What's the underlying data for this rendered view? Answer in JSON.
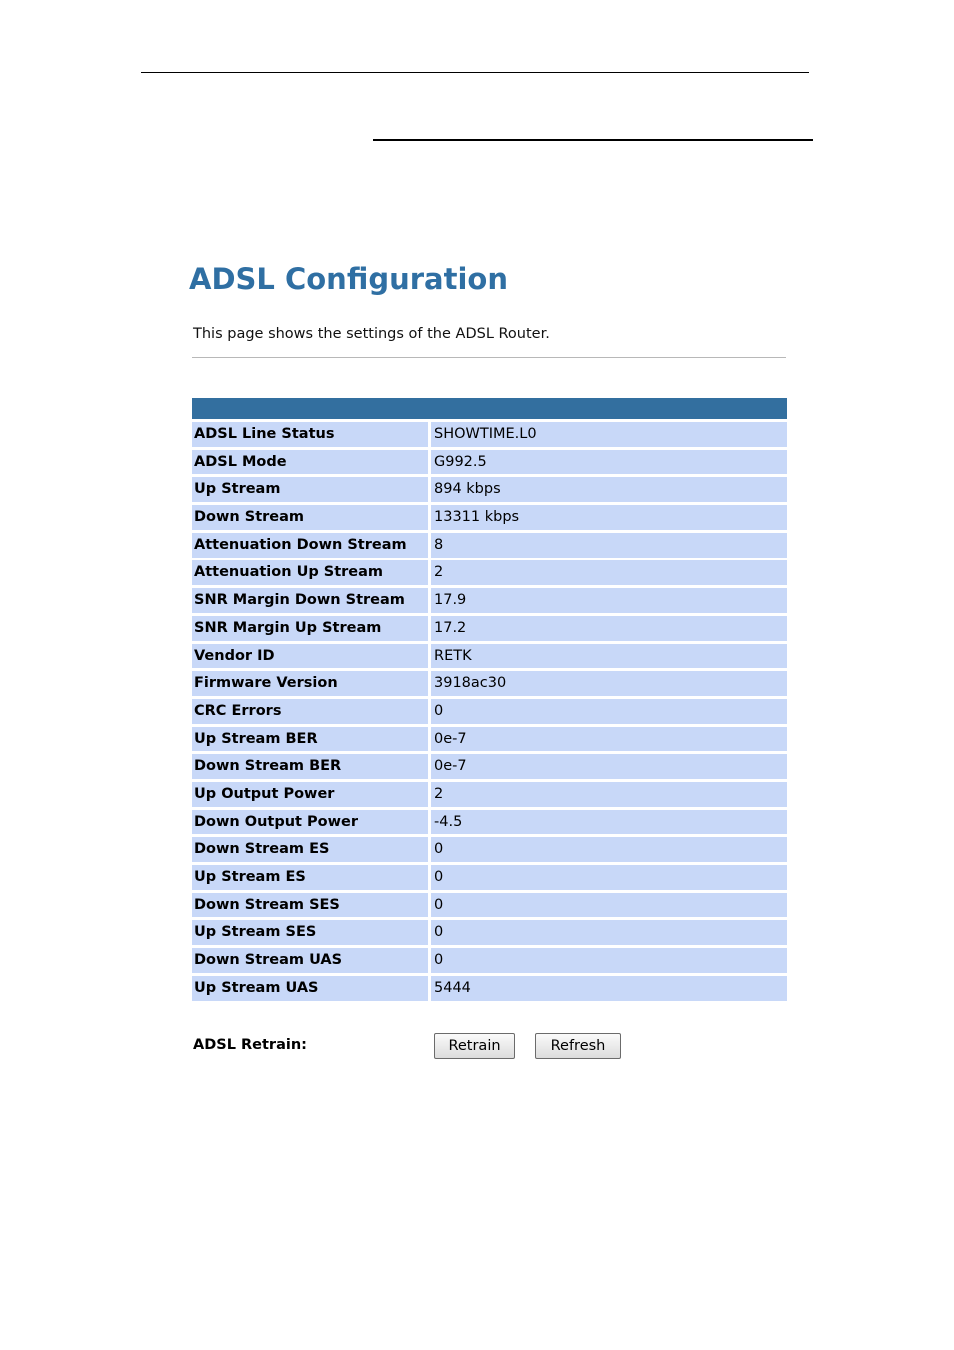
{
  "page": {
    "title": "ADSL Configuration",
    "description": "This page shows the settings of the ADSL Router."
  },
  "status_table": {
    "rows": [
      {
        "label": "ADSL Line Status",
        "value": "SHOWTIME.L0"
      },
      {
        "label": "ADSL Mode",
        "value": "G992.5"
      },
      {
        "label": "Up Stream",
        "value": "894 kbps"
      },
      {
        "label": "Down Stream",
        "value": "13311 kbps"
      },
      {
        "label": "Attenuation Down Stream",
        "value": "8"
      },
      {
        "label": "Attenuation Up Stream",
        "value": "2"
      },
      {
        "label": "SNR Margin Down Stream",
        "value": "17.9"
      },
      {
        "label": "SNR Margin Up Stream",
        "value": "17.2"
      },
      {
        "label": "Vendor ID",
        "value": "RETK"
      },
      {
        "label": "Firmware Version",
        "value": "3918ac30"
      },
      {
        "label": "CRC Errors",
        "value": "0"
      },
      {
        "label": "Up Stream BER",
        "value": "0e-7"
      },
      {
        "label": "Down Stream BER",
        "value": "0e-7"
      },
      {
        "label": "Up Output Power",
        "value": "2"
      },
      {
        "label": "Down Output Power",
        "value": "-4.5"
      },
      {
        "label": "Down Stream ES",
        "value": "0"
      },
      {
        "label": "Up Stream ES",
        "value": "0"
      },
      {
        "label": "Down Stream SES",
        "value": "0"
      },
      {
        "label": "Up Stream SES",
        "value": "0"
      },
      {
        "label": "Down Stream UAS",
        "value": "0"
      },
      {
        "label": "Up Stream UAS",
        "value": "5444"
      }
    ]
  },
  "retrain": {
    "label": "ADSL Retrain:",
    "retrain_button": "Retrain",
    "refresh_button": "Refresh"
  },
  "colors": {
    "title": "#2f6fa3",
    "table_header": "#336f9f",
    "row_background": "#c8d8f8"
  }
}
